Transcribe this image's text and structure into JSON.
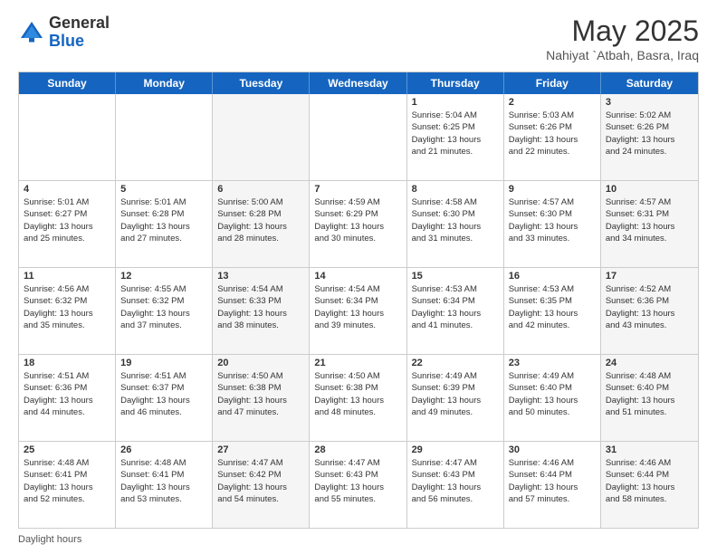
{
  "header": {
    "logo_general": "General",
    "logo_blue": "Blue",
    "month_title": "May 2025",
    "subtitle": "Nahiyat `Atbah, Basra, Iraq"
  },
  "days_of_week": [
    "Sunday",
    "Monday",
    "Tuesday",
    "Wednesday",
    "Thursday",
    "Friday",
    "Saturday"
  ],
  "footer_label": "Daylight hours",
  "rows": [
    [
      {
        "day": "",
        "lines": [],
        "alt": false
      },
      {
        "day": "",
        "lines": [],
        "alt": false
      },
      {
        "day": "",
        "lines": [],
        "alt": true
      },
      {
        "day": "",
        "lines": [],
        "alt": false
      },
      {
        "day": "1",
        "lines": [
          "Sunrise: 5:04 AM",
          "Sunset: 6:25 PM",
          "Daylight: 13 hours",
          "and 21 minutes."
        ],
        "alt": false
      },
      {
        "day": "2",
        "lines": [
          "Sunrise: 5:03 AM",
          "Sunset: 6:26 PM",
          "Daylight: 13 hours",
          "and 22 minutes."
        ],
        "alt": false
      },
      {
        "day": "3",
        "lines": [
          "Sunrise: 5:02 AM",
          "Sunset: 6:26 PM",
          "Daylight: 13 hours",
          "and 24 minutes."
        ],
        "alt": true
      }
    ],
    [
      {
        "day": "4",
        "lines": [
          "Sunrise: 5:01 AM",
          "Sunset: 6:27 PM",
          "Daylight: 13 hours",
          "and 25 minutes."
        ],
        "alt": false
      },
      {
        "day": "5",
        "lines": [
          "Sunrise: 5:01 AM",
          "Sunset: 6:28 PM",
          "Daylight: 13 hours",
          "and 27 minutes."
        ],
        "alt": false
      },
      {
        "day": "6",
        "lines": [
          "Sunrise: 5:00 AM",
          "Sunset: 6:28 PM",
          "Daylight: 13 hours",
          "and 28 minutes."
        ],
        "alt": true
      },
      {
        "day": "7",
        "lines": [
          "Sunrise: 4:59 AM",
          "Sunset: 6:29 PM",
          "Daylight: 13 hours",
          "and 30 minutes."
        ],
        "alt": false
      },
      {
        "day": "8",
        "lines": [
          "Sunrise: 4:58 AM",
          "Sunset: 6:30 PM",
          "Daylight: 13 hours",
          "and 31 minutes."
        ],
        "alt": false
      },
      {
        "day": "9",
        "lines": [
          "Sunrise: 4:57 AM",
          "Sunset: 6:30 PM",
          "Daylight: 13 hours",
          "and 33 minutes."
        ],
        "alt": false
      },
      {
        "day": "10",
        "lines": [
          "Sunrise: 4:57 AM",
          "Sunset: 6:31 PM",
          "Daylight: 13 hours",
          "and 34 minutes."
        ],
        "alt": true
      }
    ],
    [
      {
        "day": "11",
        "lines": [
          "Sunrise: 4:56 AM",
          "Sunset: 6:32 PM",
          "Daylight: 13 hours",
          "and 35 minutes."
        ],
        "alt": false
      },
      {
        "day": "12",
        "lines": [
          "Sunrise: 4:55 AM",
          "Sunset: 6:32 PM",
          "Daylight: 13 hours",
          "and 37 minutes."
        ],
        "alt": false
      },
      {
        "day": "13",
        "lines": [
          "Sunrise: 4:54 AM",
          "Sunset: 6:33 PM",
          "Daylight: 13 hours",
          "and 38 minutes."
        ],
        "alt": true
      },
      {
        "day": "14",
        "lines": [
          "Sunrise: 4:54 AM",
          "Sunset: 6:34 PM",
          "Daylight: 13 hours",
          "and 39 minutes."
        ],
        "alt": false
      },
      {
        "day": "15",
        "lines": [
          "Sunrise: 4:53 AM",
          "Sunset: 6:34 PM",
          "Daylight: 13 hours",
          "and 41 minutes."
        ],
        "alt": false
      },
      {
        "day": "16",
        "lines": [
          "Sunrise: 4:53 AM",
          "Sunset: 6:35 PM",
          "Daylight: 13 hours",
          "and 42 minutes."
        ],
        "alt": false
      },
      {
        "day": "17",
        "lines": [
          "Sunrise: 4:52 AM",
          "Sunset: 6:36 PM",
          "Daylight: 13 hours",
          "and 43 minutes."
        ],
        "alt": true
      }
    ],
    [
      {
        "day": "18",
        "lines": [
          "Sunrise: 4:51 AM",
          "Sunset: 6:36 PM",
          "Daylight: 13 hours",
          "and 44 minutes."
        ],
        "alt": false
      },
      {
        "day": "19",
        "lines": [
          "Sunrise: 4:51 AM",
          "Sunset: 6:37 PM",
          "Daylight: 13 hours",
          "and 46 minutes."
        ],
        "alt": false
      },
      {
        "day": "20",
        "lines": [
          "Sunrise: 4:50 AM",
          "Sunset: 6:38 PM",
          "Daylight: 13 hours",
          "and 47 minutes."
        ],
        "alt": true
      },
      {
        "day": "21",
        "lines": [
          "Sunrise: 4:50 AM",
          "Sunset: 6:38 PM",
          "Daylight: 13 hours",
          "and 48 minutes."
        ],
        "alt": false
      },
      {
        "day": "22",
        "lines": [
          "Sunrise: 4:49 AM",
          "Sunset: 6:39 PM",
          "Daylight: 13 hours",
          "and 49 minutes."
        ],
        "alt": false
      },
      {
        "day": "23",
        "lines": [
          "Sunrise: 4:49 AM",
          "Sunset: 6:40 PM",
          "Daylight: 13 hours",
          "and 50 minutes."
        ],
        "alt": false
      },
      {
        "day": "24",
        "lines": [
          "Sunrise: 4:48 AM",
          "Sunset: 6:40 PM",
          "Daylight: 13 hours",
          "and 51 minutes."
        ],
        "alt": true
      }
    ],
    [
      {
        "day": "25",
        "lines": [
          "Sunrise: 4:48 AM",
          "Sunset: 6:41 PM",
          "Daylight: 13 hours",
          "and 52 minutes."
        ],
        "alt": false
      },
      {
        "day": "26",
        "lines": [
          "Sunrise: 4:48 AM",
          "Sunset: 6:41 PM",
          "Daylight: 13 hours",
          "and 53 minutes."
        ],
        "alt": false
      },
      {
        "day": "27",
        "lines": [
          "Sunrise: 4:47 AM",
          "Sunset: 6:42 PM",
          "Daylight: 13 hours",
          "and 54 minutes."
        ],
        "alt": true
      },
      {
        "day": "28",
        "lines": [
          "Sunrise: 4:47 AM",
          "Sunset: 6:43 PM",
          "Daylight: 13 hours",
          "and 55 minutes."
        ],
        "alt": false
      },
      {
        "day": "29",
        "lines": [
          "Sunrise: 4:47 AM",
          "Sunset: 6:43 PM",
          "Daylight: 13 hours",
          "and 56 minutes."
        ],
        "alt": false
      },
      {
        "day": "30",
        "lines": [
          "Sunrise: 4:46 AM",
          "Sunset: 6:44 PM",
          "Daylight: 13 hours",
          "and 57 minutes."
        ],
        "alt": false
      },
      {
        "day": "31",
        "lines": [
          "Sunrise: 4:46 AM",
          "Sunset: 6:44 PM",
          "Daylight: 13 hours",
          "and 58 minutes."
        ],
        "alt": true
      }
    ]
  ]
}
